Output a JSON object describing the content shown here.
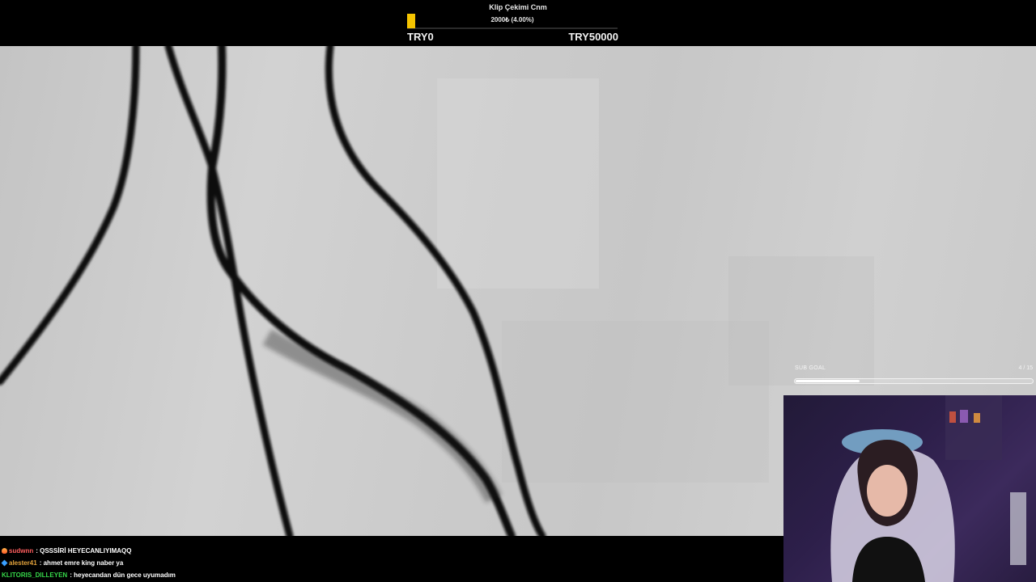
{
  "donation_goal": {
    "title": "Klip Çekimi Cnm",
    "amount": "2000₺ (4.00%)",
    "progress_fraction": 0.04,
    "min_label": "TRY0",
    "max_label": "TRY50000",
    "bar_color": "#f5c400"
  },
  "sub_goal": {
    "label": "SUB GOAL",
    "count": "4 / 15",
    "progress_fraction": 0.27
  },
  "chat": {
    "messages": [
      {
        "user": "sudwnn",
        "separator": ":",
        "text": "QSSSİRİ HEYECANLIYIMAQQ",
        "user_color": "#ff5e5e",
        "badge_icon": "flame-icon"
      },
      {
        "user": "alester41",
        "separator": ":",
        "text": "ahmet emre king naber ya",
        "user_color": "#e3a33b",
        "badge_icon": "gem-icon"
      },
      {
        "user": "KLITORIS_DILLEYEN",
        "separator": ":",
        "text": "heyecandan dün gece uyumadım",
        "user_color": "#37d84a",
        "badge_icon": ""
      }
    ]
  },
  "webcam": {
    "icon": "webcam-feed-icon"
  }
}
